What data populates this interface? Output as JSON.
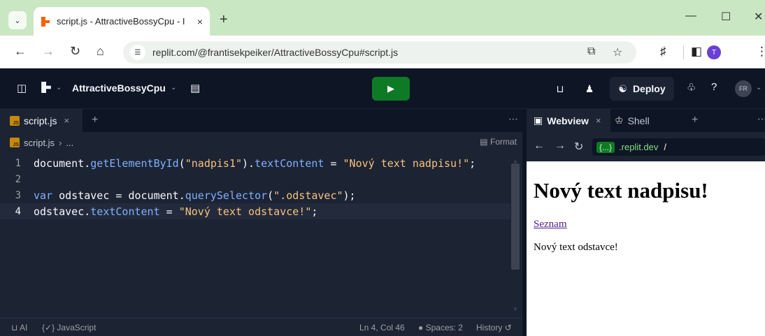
{
  "browser": {
    "tab_title": "script.js - AttractiveBossyCpu - I",
    "tab_close": "×",
    "new_tab": "+",
    "url": "replit.com/@frantisekpeiker/AttractiveBossyCpu#script.js",
    "profile_initial": "T",
    "accent": "#c9e7c3"
  },
  "replit": {
    "repl_name": "AttractiveBossyCpu",
    "deploy_label": "Deploy",
    "avatar_initials": "FR",
    "run_color": "#0f7a25"
  },
  "editor": {
    "tab_label": "script.js",
    "breadcrumb_file": "script.js",
    "breadcrumb_more": "...",
    "format_label": "Format",
    "lines": [
      {
        "n": "1",
        "tokens": [
          [
            "tk-id",
            "document"
          ],
          [
            "tk-pun",
            "."
          ],
          [
            "tk-fn",
            "getElementById"
          ],
          [
            "tk-pun",
            "("
          ],
          [
            "tk-str",
            "\"nadpis1\""
          ],
          [
            "tk-pun",
            ")."
          ],
          [
            "tk-prop",
            "textContent"
          ],
          [
            "tk-pun",
            " = "
          ],
          [
            "tk-str",
            "\"Nový text nadpisu!\""
          ],
          [
            "tk-pun",
            ";"
          ]
        ]
      },
      {
        "n": "2",
        "tokens": []
      },
      {
        "n": "3",
        "tokens": [
          [
            "tk-kw",
            "var"
          ],
          [
            "tk-id",
            " odstavec "
          ],
          [
            "tk-pun",
            "= "
          ],
          [
            "tk-id",
            "document"
          ],
          [
            "tk-pun",
            "."
          ],
          [
            "tk-fn",
            "querySelector"
          ],
          [
            "tk-pun",
            "("
          ],
          [
            "tk-str",
            "\".odstavec\""
          ],
          [
            "tk-pun",
            ");"
          ]
        ]
      },
      {
        "n": "4",
        "active": true,
        "tokens": [
          [
            "tk-id",
            "odstavec"
          ],
          [
            "tk-pun",
            "."
          ],
          [
            "tk-prop",
            "textContent"
          ],
          [
            "tk-pun",
            " = "
          ],
          [
            "tk-str",
            "\"Nový text odstavce!\""
          ],
          [
            "tk-pun",
            ";"
          ]
        ]
      }
    ],
    "status": {
      "ai": "AI",
      "language": "JavaScript",
      "position": "Ln 4, Col 46",
      "spaces": "Spaces: 2",
      "history": "History"
    }
  },
  "webview": {
    "tab_webview": "Webview",
    "tab_shell": "Shell",
    "url_chip": "{...}",
    "url_domain": ".replit.dev",
    "url_path": "/",
    "heading": "Nový text nadpisu!",
    "link": "Seznam",
    "paragraph": "Nový text odstavce!"
  }
}
